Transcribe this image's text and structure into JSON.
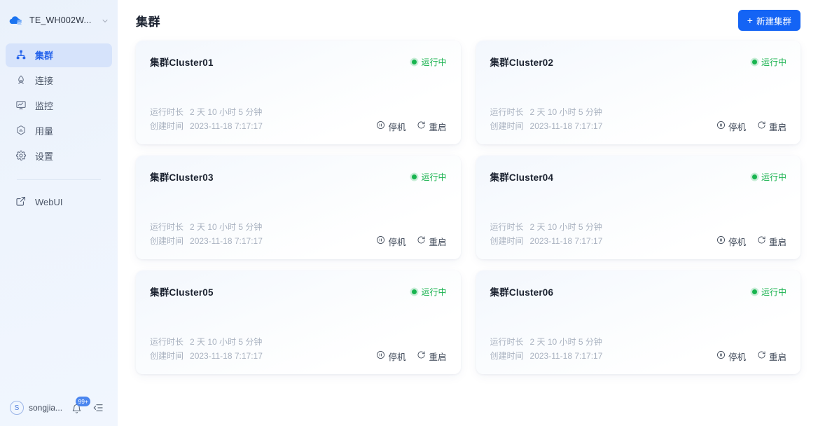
{
  "sidebar": {
    "brand": {
      "name": "TE_WH002W...",
      "logo_icon": "cloud-database-icon",
      "caret_icon": "chevron-down-icon"
    },
    "items": [
      {
        "label": "集群",
        "icon": "cluster-icon",
        "active": true
      },
      {
        "label": "连接",
        "icon": "connection-icon",
        "active": false
      },
      {
        "label": "监控",
        "icon": "monitor-icon",
        "active": false
      },
      {
        "label": "用量",
        "icon": "usage-icon",
        "active": false
      },
      {
        "label": "设置",
        "icon": "gear-icon",
        "active": false
      }
    ],
    "external": {
      "label": "WebUI",
      "icon": "external-link-icon"
    },
    "user": {
      "avatar_initial": "S",
      "name": "songjia...",
      "notification_badge": "99+",
      "bell_icon": "bell-icon",
      "collapse_icon": "collapse-sidebar-icon"
    }
  },
  "header": {
    "title": "集群",
    "new_cluster_label": "新建集群",
    "new_cluster_plus": "+"
  },
  "labels": {
    "uptime": "运行时长",
    "created": "创建时间",
    "stop": "停机",
    "restart": "重启",
    "stop_icon": "pause-circle-icon",
    "restart_icon": "restart-icon"
  },
  "colors": {
    "accent": "#1464f5",
    "status_running": "#18b24e",
    "sidebar_active_bg": "#d6e3fb",
    "sidebar_bg": "#eef4fd",
    "muted_text": "#a9b2c0"
  },
  "clusters": [
    {
      "name": "集群Cluster01",
      "status": "运行中",
      "uptime": "2 天 10 小时 5 分钟",
      "created": "2023-11-18 7:17:17"
    },
    {
      "name": "集群Cluster02",
      "status": "运行中",
      "uptime": "2 天 10 小时 5 分钟",
      "created": "2023-11-18 7:17:17"
    },
    {
      "name": "集群Cluster03",
      "status": "运行中",
      "uptime": "2 天 10 小时 5 分钟",
      "created": "2023-11-18 7:17:17"
    },
    {
      "name": "集群Cluster04",
      "status": "运行中",
      "uptime": "2 天 10 小时 5 分钟",
      "created": "2023-11-18 7:17:17"
    },
    {
      "name": "集群Cluster05",
      "status": "运行中",
      "uptime": "2 天 10 小时 5 分钟",
      "created": "2023-11-18 7:17:17"
    },
    {
      "name": "集群Cluster06",
      "status": "运行中",
      "uptime": "2 天 10 小时 5 分钟",
      "created": "2023-11-18 7:17:17"
    }
  ]
}
